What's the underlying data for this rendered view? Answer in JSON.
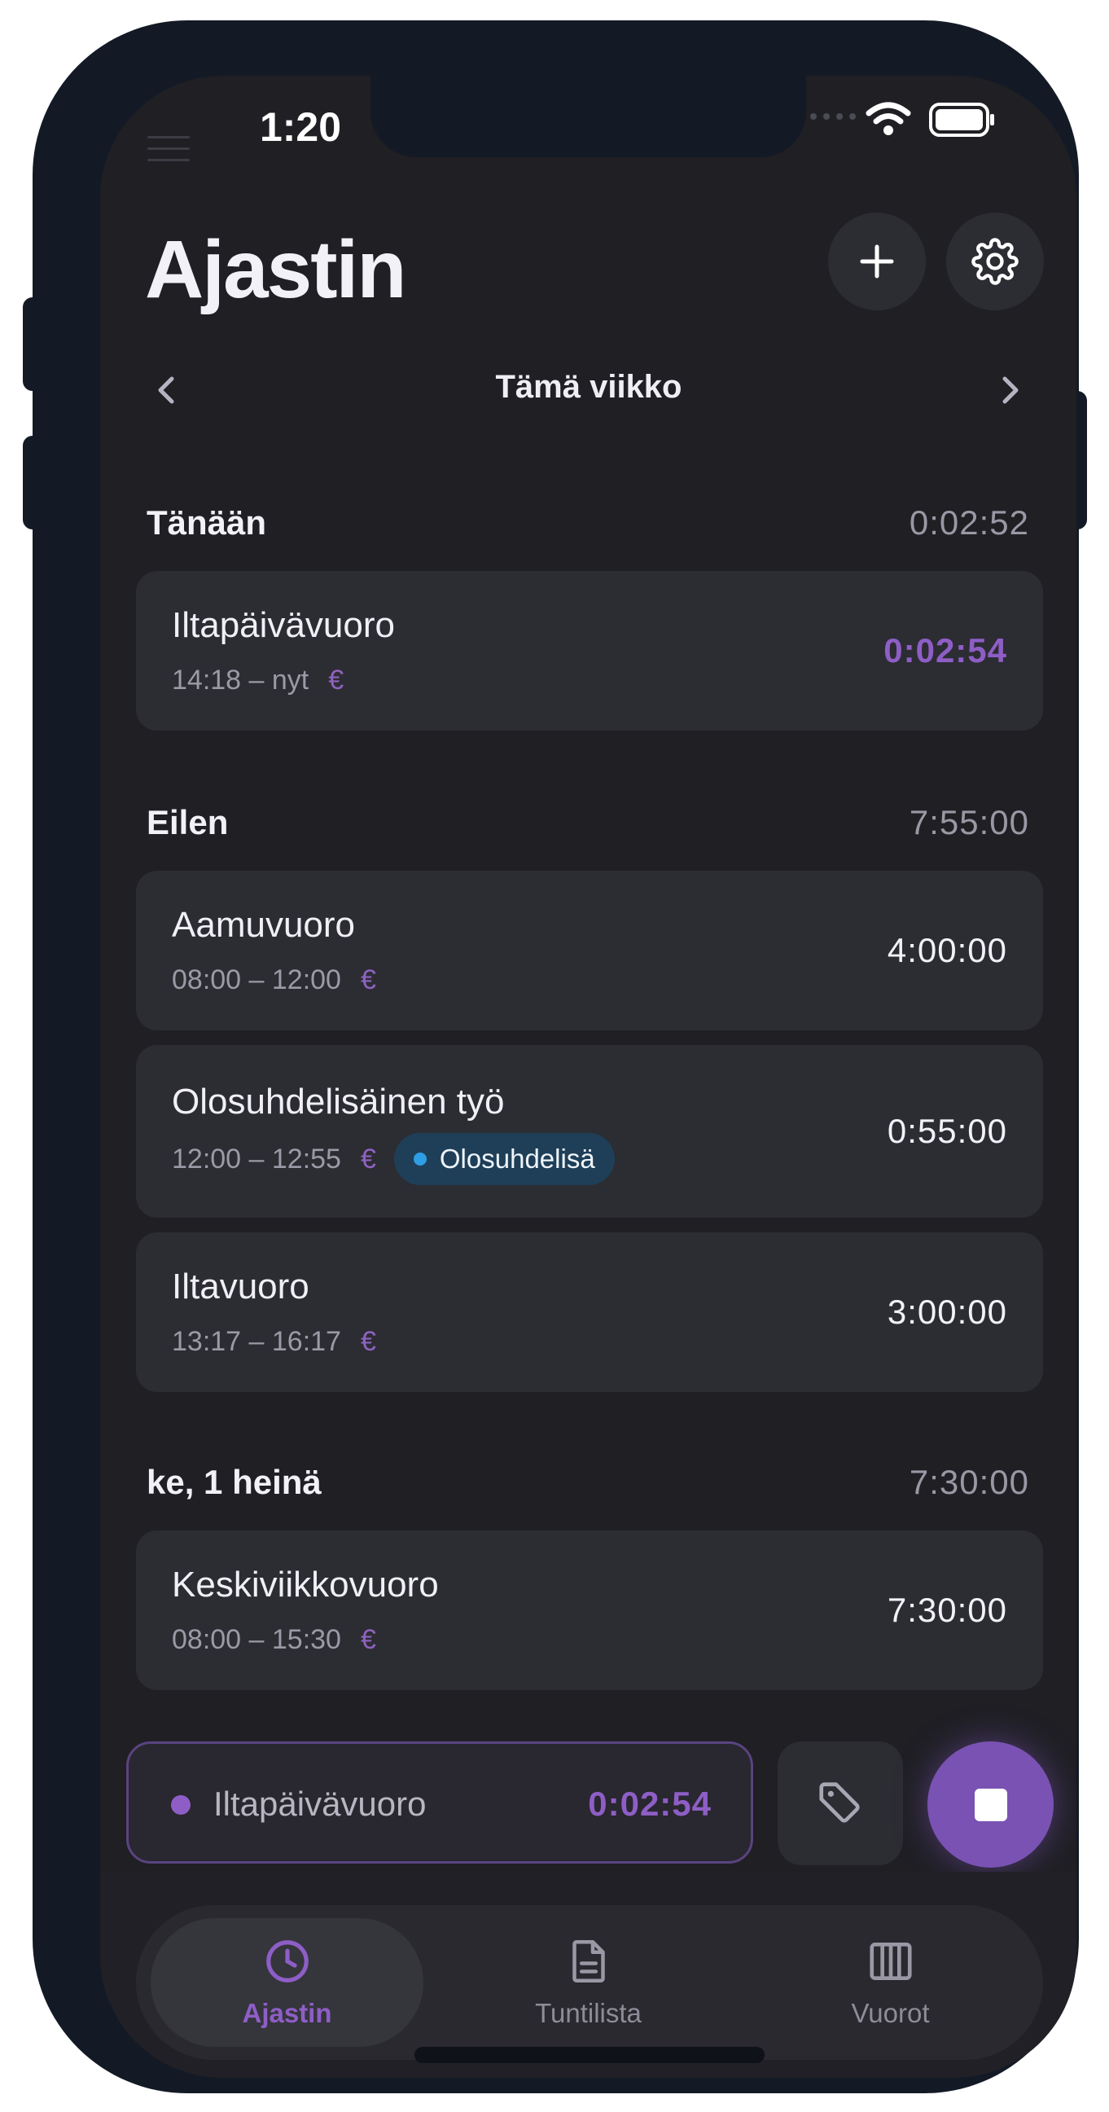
{
  "status_bar": {
    "time": "1:20"
  },
  "header": {
    "title": "Ajastin",
    "add_icon": "plus-icon",
    "settings_icon": "gear-icon"
  },
  "week_nav": {
    "label": "Tämä viikko"
  },
  "sections": [
    {
      "title": "Tänään",
      "total": "0:02:52",
      "entries": [
        {
          "name": "Iltapäivävuoro",
          "time": "14:18 – nyt",
          "duration": "0:02:54",
          "live": true
        }
      ]
    },
    {
      "title": "Eilen",
      "total": "7:55:00",
      "entries": [
        {
          "name": "Aamuvuoro",
          "time": "08:00 – 12:00",
          "duration": "4:00:00"
        },
        {
          "name": "Olosuhdelisäinen työ",
          "time": "12:00 – 12:55",
          "duration": "0:55:00",
          "tag": "Olosuhdelisä"
        },
        {
          "name": "Iltavuoro",
          "time": "13:17 – 16:17",
          "duration": "3:00:00"
        }
      ]
    },
    {
      "title": "ke, 1 heinä",
      "total": "7:30:00",
      "entries": [
        {
          "name": "Keskiviikkovuoro",
          "time": "08:00 – 15:30",
          "duration": "7:30:00"
        }
      ]
    }
  ],
  "billable_symbol": "€",
  "running": {
    "name": "Iltapäivävuoro",
    "time": "0:02:54"
  },
  "tabs": [
    {
      "label": "Ajastin",
      "icon": "clock-icon",
      "active": true
    },
    {
      "label": "Tuntilista",
      "icon": "document-icon",
      "active": false
    },
    {
      "label": "Vuorot",
      "icon": "columns-icon",
      "active": false
    }
  ],
  "colors": {
    "accent": "#8e5ec6",
    "background": "#1f1f24",
    "card": "#2c2c33",
    "tag": "#1f3f58",
    "tag_dot": "#2e9fe6"
  }
}
